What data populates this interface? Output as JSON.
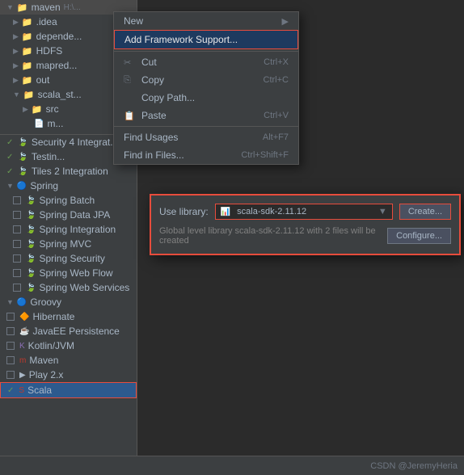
{
  "fileTree": {
    "items": [
      {
        "label": "maven",
        "type": "folder",
        "indent": 0,
        "expanded": true,
        "prefix": "▼",
        "extra": "H:\\..."
      },
      {
        "label": ".idea",
        "type": "folder",
        "indent": 1,
        "expanded": false,
        "prefix": "▶"
      },
      {
        "label": "depende...",
        "type": "folder",
        "indent": 1,
        "expanded": false,
        "prefix": "▶"
      },
      {
        "label": "HDFS",
        "type": "folder",
        "indent": 1,
        "expanded": false,
        "prefix": "▶"
      },
      {
        "label": "mapred...",
        "type": "folder",
        "indent": 1,
        "expanded": false,
        "prefix": "▶"
      },
      {
        "label": "out",
        "type": "folder",
        "indent": 1,
        "expanded": false,
        "prefix": "▶"
      },
      {
        "label": "scala_st...",
        "type": "folder",
        "indent": 1,
        "expanded": true,
        "prefix": "▼"
      },
      {
        "label": "src",
        "type": "folder",
        "indent": 2,
        "expanded": false,
        "prefix": "▶"
      },
      {
        "label": "m...",
        "type": "file",
        "indent": 2
      }
    ]
  },
  "frameworkItems": [
    {
      "label": "Security 4 Integrat...",
      "checked": true,
      "checkType": "green"
    },
    {
      "label": "Testin...",
      "checked": true,
      "checkType": "green"
    },
    {
      "label": "Tiles 2 Integration",
      "checked": true,
      "checkType": "green"
    },
    {
      "label": "Spring",
      "checked": false,
      "checkType": "section",
      "isSection": true
    },
    {
      "label": "Spring Batch",
      "checked": false,
      "checkType": "unchecked"
    },
    {
      "label": "Spring Data JPA",
      "checked": false,
      "checkType": "unchecked"
    },
    {
      "label": "Spring Integration",
      "checked": false,
      "checkType": "unchecked"
    },
    {
      "label": "Spring MVC",
      "checked": false,
      "checkType": "unchecked"
    },
    {
      "label": "Spring Security",
      "checked": false,
      "checkType": "unchecked"
    },
    {
      "label": "Spring Web Flow",
      "checked": false,
      "checkType": "unchecked"
    },
    {
      "label": "Spring Web Services",
      "checked": false,
      "checkType": "unchecked"
    },
    {
      "label": "Groovy",
      "checked": false,
      "checkType": "section",
      "isSection": true
    },
    {
      "label": "Hibernate",
      "checked": false,
      "checkType": "unchecked"
    },
    {
      "label": "JavaEE Persistence",
      "checked": false,
      "checkType": "unchecked"
    },
    {
      "label": "Kotlin/JVM",
      "checked": false,
      "checkType": "unchecked"
    },
    {
      "label": "Maven",
      "checked": false,
      "checkType": "unchecked"
    },
    {
      "label": "Play 2.x",
      "checked": false,
      "checkType": "unchecked"
    },
    {
      "label": "Scala",
      "checked": true,
      "checkType": "checked",
      "selected": true
    }
  ],
  "contextMenu": {
    "items": [
      {
        "label": "New",
        "shortcut": "",
        "hasSub": true
      },
      {
        "label": "Add Framework Support...",
        "shortcut": "",
        "highlighted": true
      },
      {
        "label": "Cut",
        "shortcut": "Ctrl+X",
        "icon": "✂"
      },
      {
        "label": "Copy",
        "shortcut": "Ctrl+C",
        "icon": "⎘"
      },
      {
        "label": "Copy Path...",
        "shortcut": "",
        "icon": ""
      },
      {
        "label": "Paste",
        "shortcut": "Ctrl+V",
        "icon": "📋"
      },
      {
        "label": "Find Usages",
        "shortcut": "Alt+F7"
      },
      {
        "label": "Find in Files...",
        "shortcut": "Ctrl+Shift+F"
      }
    ]
  },
  "dialog": {
    "useLibraryLabel": "Use library:",
    "libraryName": "scala-sdk-2.11.12",
    "libraryIcon": "📊",
    "createButton": "Create...",
    "configureButton": "Configure...",
    "infoText": "Global level library scala-sdk-2.11.12 with 2 files will be created"
  },
  "bottomBar": {
    "watermark": "CSDN @JeremyHeria"
  }
}
